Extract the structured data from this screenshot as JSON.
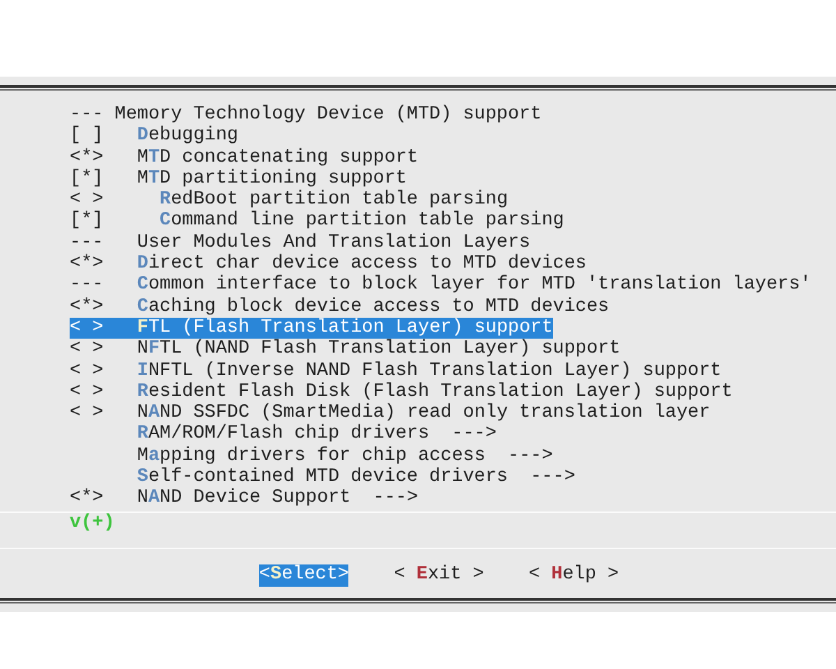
{
  "header": "--- Memory Technology Device (MTD) support",
  "items": [
    {
      "marker": "[ ]",
      "hotkey": "D",
      "after": "ebugging",
      "selected": false
    },
    {
      "marker": "<*>",
      "before": "M",
      "hotkey": "T",
      "after": "D concatenating support",
      "selected": false
    },
    {
      "marker": "[*]",
      "before": "M",
      "hotkey": "T",
      "after": "D partitioning support",
      "selected": false,
      "children": [
        {
          "marker": "< >",
          "hotkey": "R",
          "after": "edBoot partition table parsing",
          "selected": false
        },
        {
          "marker": "[*]",
          "hotkey": "C",
          "after": "ommand line partition table parsing",
          "selected": false
        }
      ]
    },
    {
      "marker": "---",
      "before": "User Modules And Translation Layers",
      "selected": false
    },
    {
      "marker": "<*>",
      "hotkey": "D",
      "after": "irect char device access to MTD devices",
      "selected": false
    },
    {
      "marker": "---",
      "hotkey": "C",
      "after": "ommon interface to block layer for MTD 'translation layers'",
      "selected": false
    },
    {
      "marker": "<*>",
      "hotkey": "C",
      "after": "aching block device access to MTD devices",
      "selected": false
    },
    {
      "marker": "< >",
      "hotkey": "F",
      "after": "TL (Flash Translation Layer) support",
      "selected": true
    },
    {
      "marker": "< >",
      "before": "N",
      "hotkey": "F",
      "after": "TL (NAND Flash Translation Layer) support",
      "selected": false
    },
    {
      "marker": "< >",
      "hotkey": "I",
      "after": "NFTL (Inverse NAND Flash Translation Layer) support",
      "selected": false
    },
    {
      "marker": "< >",
      "hotkey": "R",
      "after": "esident Flash Disk (Flash Translation Layer) support",
      "selected": false
    },
    {
      "marker": "< >",
      "before": "N",
      "hotkey": "A",
      "after": "ND SSFDC (SmartMedia) read only translation layer",
      "selected": false
    },
    {
      "hotkey": "R",
      "after": "AM/ROM/Flash chip drivers  --->",
      "selected": false
    },
    {
      "before": "M",
      "hotkey": "a",
      "after": "pping drivers for chip access  --->",
      "selected": false
    },
    {
      "hotkey": "S",
      "after": "elf-contained MTD device drivers  --->",
      "selected": false
    },
    {
      "marker": "<*>",
      "before": "N",
      "hotkey": "A",
      "after": "ND Device Support  --->",
      "selected": false
    }
  ],
  "more_indicator": "v(+)",
  "buttons": [
    {
      "before": "<",
      "hotkey": "S",
      "after": "elect>",
      "selected": true
    },
    {
      "before": "< ",
      "hotkey": "E",
      "after": "xit >",
      "selected": false
    },
    {
      "before": "< ",
      "hotkey": "H",
      "after": "elp >",
      "selected": false
    }
  ]
}
